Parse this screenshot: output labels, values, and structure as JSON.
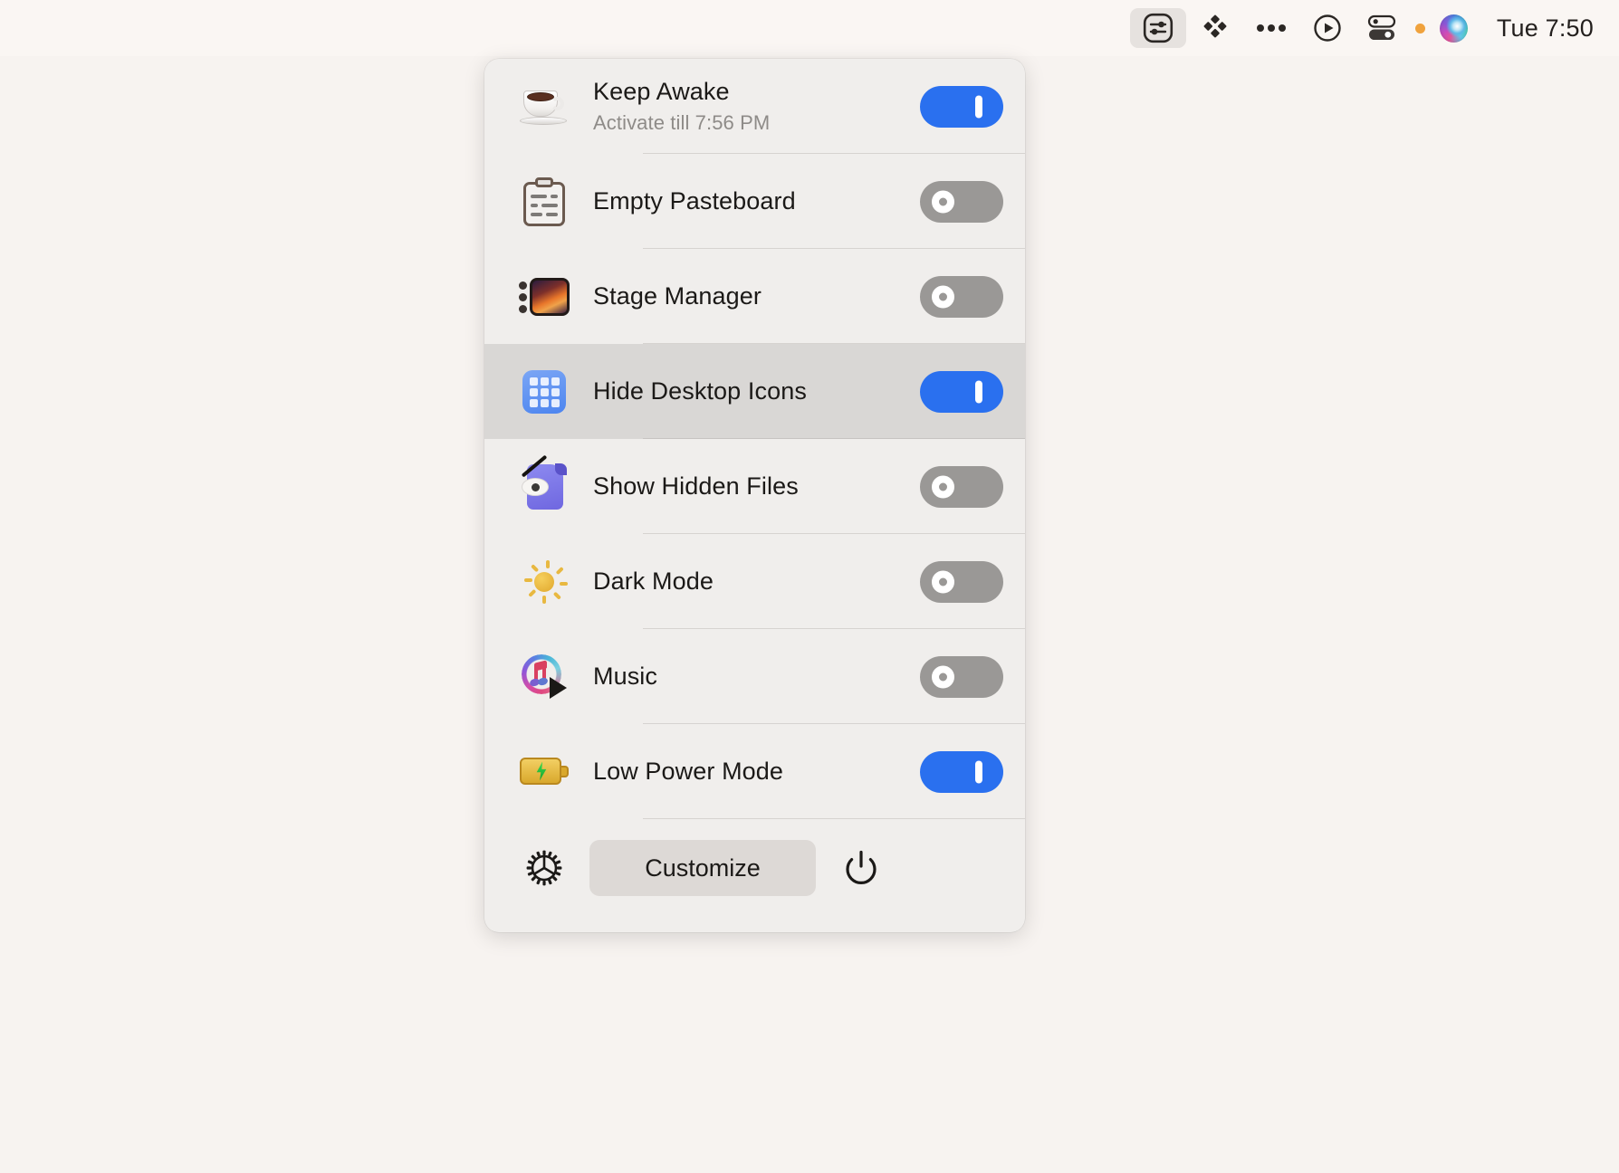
{
  "menubar": {
    "icons": [
      {
        "name": "one-switch-app-icon",
        "glyph": "sliders-rounded-square",
        "active": true
      },
      {
        "name": "dropbox-icon",
        "glyph": "diamond-cluster",
        "active": false
      },
      {
        "name": "overflow-menu-icon",
        "glyph": "ellipsis",
        "active": false
      },
      {
        "name": "play-circle-icon",
        "glyph": "play-circle",
        "active": false
      },
      {
        "name": "control-toggles-icon",
        "glyph": "dual-toggle",
        "active": false
      },
      {
        "name": "siri-icon",
        "glyph": "siri-orb",
        "active": false
      }
    ],
    "clock": "Tue 7:50",
    "status_dot_color": "#f0a23c"
  },
  "panel": {
    "background": "#f0eeec",
    "accent_on": "#2a70ef",
    "accent_off": "#9a9896",
    "selected_row_background": "#d9d7d5",
    "rows": [
      {
        "id": "keep-awake",
        "icon": "coffee-cup-icon",
        "title": "Keep Awake",
        "subtitle": "Activate till 7:56 PM",
        "state": "on",
        "selected": false
      },
      {
        "id": "empty-pasteboard",
        "icon": "clipboard-icon",
        "title": "Empty Pasteboard",
        "subtitle": "",
        "state": "off",
        "selected": false
      },
      {
        "id": "stage-manager",
        "icon": "stage-manager-icon",
        "title": "Stage Manager",
        "subtitle": "",
        "state": "off",
        "selected": false
      },
      {
        "id": "hide-desktop-icons",
        "icon": "desktop-grid-icon",
        "title": "Hide Desktop Icons",
        "subtitle": "",
        "state": "on",
        "selected": true
      },
      {
        "id": "show-hidden-files",
        "icon": "hidden-files-icon",
        "title": "Show Hidden Files",
        "subtitle": "",
        "state": "off",
        "selected": false
      },
      {
        "id": "dark-mode",
        "icon": "sun-icon",
        "title": "Dark Mode",
        "subtitle": "",
        "state": "off",
        "selected": false
      },
      {
        "id": "music",
        "icon": "music-icon",
        "title": "Music",
        "subtitle": "",
        "state": "off",
        "selected": false
      },
      {
        "id": "low-power-mode",
        "icon": "battery-bolt-icon",
        "title": "Low Power Mode",
        "subtitle": "",
        "state": "on",
        "selected": false
      }
    ],
    "footer": {
      "settings_icon": "gear-icon",
      "customize_label": "Customize",
      "quit_icon": "power-icon"
    }
  }
}
